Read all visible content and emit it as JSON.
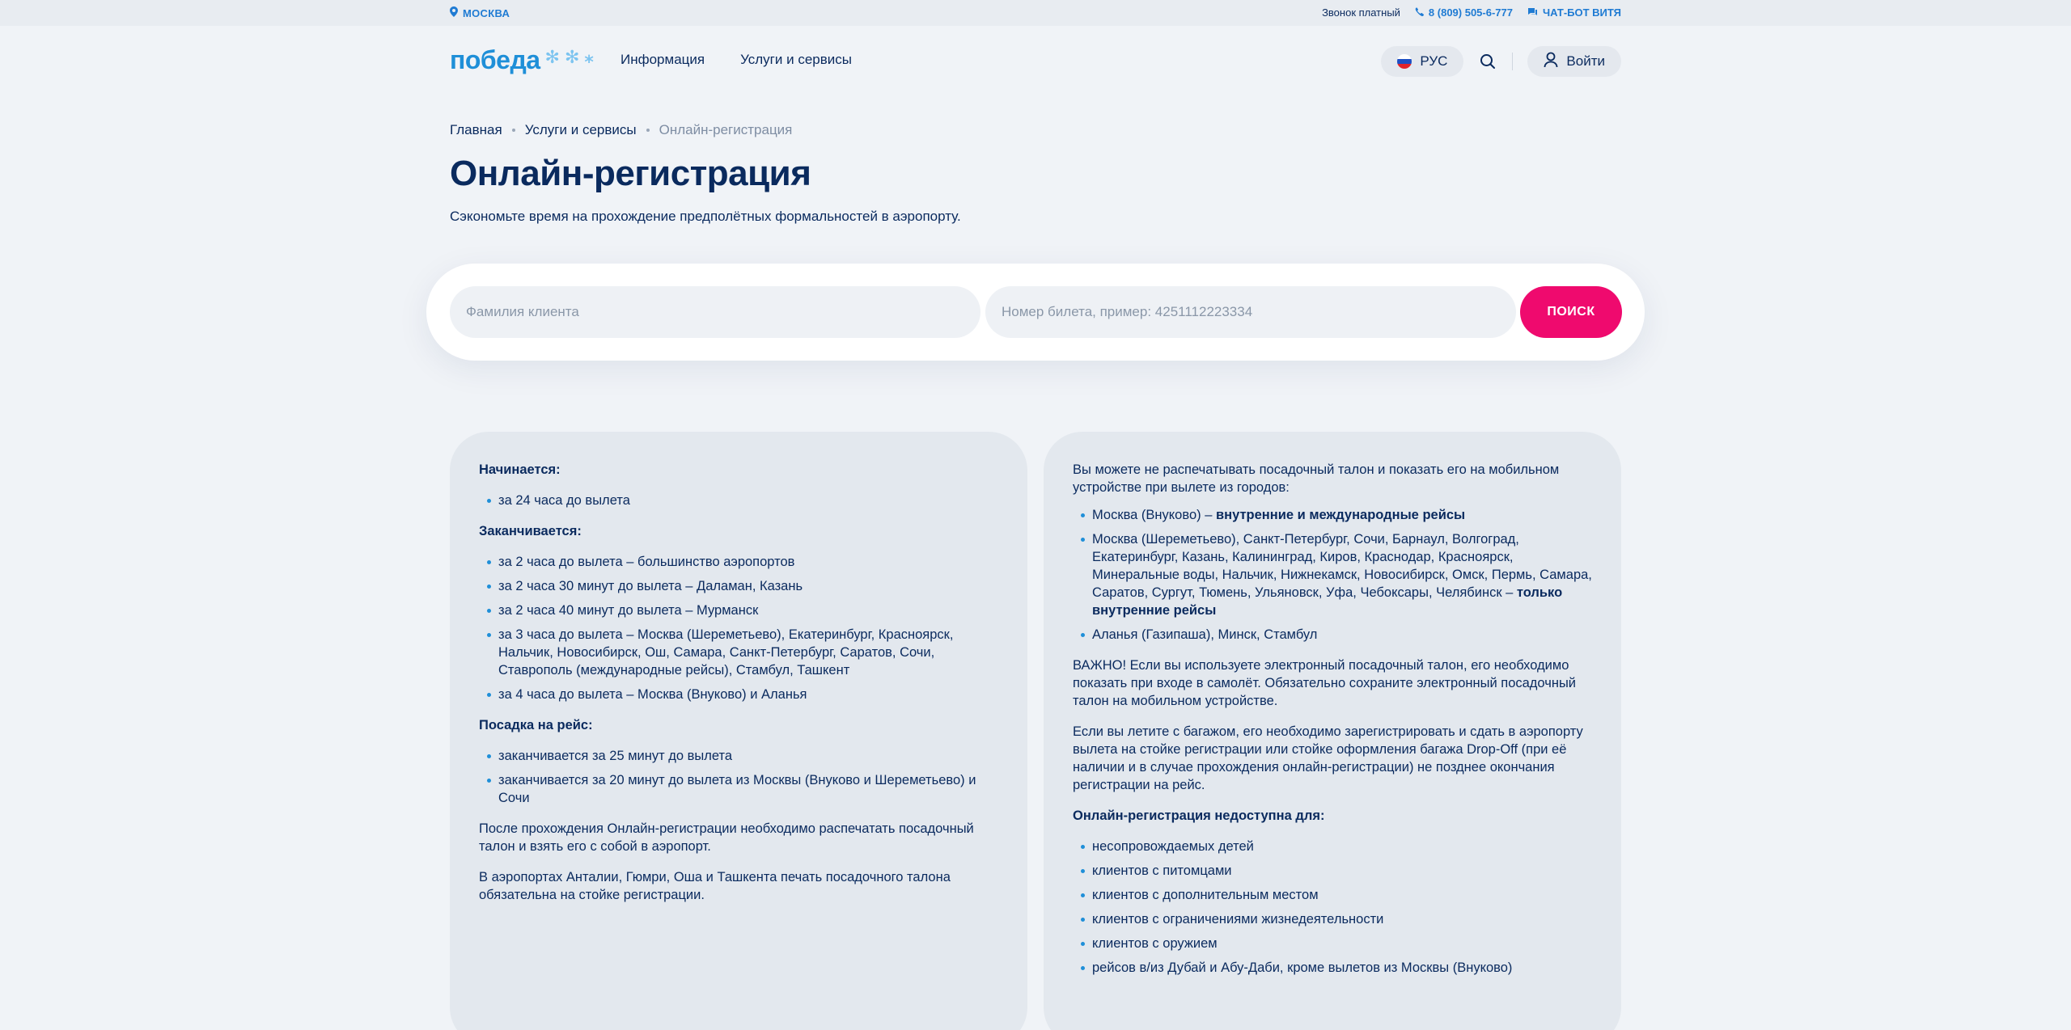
{
  "topbar": {
    "city": "МОСКВА",
    "paid_call": "Звонок платный",
    "phone": "8 (809) 505-6-777",
    "chat": "ЧАТ-БОТ ВИТЯ"
  },
  "header": {
    "logo": "победа",
    "nav": [
      "Информация",
      "Услуги и сервисы"
    ],
    "lang": "РУС",
    "login": "Войти"
  },
  "breadcrumb": [
    "Главная",
    "Услуги и сервисы",
    "Онлайн-регистрация"
  ],
  "page": {
    "title": "Онлайн-регистрация",
    "subtitle": "Сэкономьте время на прохождение предполётных формальностей в аэропорту."
  },
  "search": {
    "surname_placeholder": "Фамилия клиента",
    "ticket_placeholder": "Номер билета, пример: 4251112223334",
    "button": "ПОИСК"
  },
  "left_card": {
    "starts_title": "Начинается:",
    "starts": [
      "за 24 часа до вылета"
    ],
    "ends_title": "Заканчивается:",
    "ends": [
      "за 2 часа до вылета – большинство аэропортов",
      "за 2 часа 30 минут до вылета – Даламан, Казань",
      "за 2 часа 40 минут до вылета – Мурманск",
      "за 3 часа до вылета – Москва (Шереметьево), Екатеринбург, Красноярск, Нальчик, Новосибирск, Ош, Самара, Санкт-Петербург, Саратов, Сочи, Ставрополь (международные рейсы), Стамбул,  Ташкент",
      "за 4 часа до вылета – Москва (Внуково) и Аланья"
    ],
    "boarding_title": "Посадка на рейс:",
    "boarding": [
      "заканчивается за 25 минут до вылета",
      "заканчивается за 20 минут до вылета из Москвы (Внуково и Шереметьево) и Сочи"
    ],
    "p1": "После прохождения Онлайн-регистрации необходимо распечатать посадочный талон и взять его с собой в аэропорт.",
    "p2": "В аэропортах Анталии, Гюмри, Оша и Ташкента печать посадочного талона обязательна на стойке регистрации."
  },
  "right_card": {
    "intro": "Вы можете не распечатывать посадочный талон и показать его на мобильном устройстве при вылете из городов:",
    "city1_text": "Москва (Внуково) – ",
    "city1_bold": "внутренние и международные рейсы",
    "city2_text": "Москва (Шереметьево), Санкт-Петербург, Сочи, Барнаул, Волгоград, Екатеринбург, Казань, Калининград, Киров, Краснодар, Красноярск, Минеральные воды, Нальчик, Нижнекамск, Новосибирск, Омск, Пермь, Самара, Саратов, Сургут, Тюмень, Ульяновск, Уфа, Чебоксары, Челябинск – ",
    "city2_bold": "только внутренние рейсы",
    "city3_text": "Аланья (Газипаша), Минск, Стамбул",
    "p_important": "ВАЖНО! Если вы используете электронный посадочный талон, его необходимо показать при входе в самолёт. Обязательно сохраните электронный посадочный талон на мобильном устройстве.",
    "p_baggage": "Если вы летите с багажом, его необходимо зарегистрировать и сдать в аэропорту вылета на стойке регистрации или стойке оформления багажа Drop-Off (при её наличии и в случае прохождения онлайн-регистрации) не позднее окончания регистрации на рейс.",
    "unavailable_title": "Онлайн-регистрация недоступна для:",
    "unavailable": [
      "несопровождаемых детей",
      "клиентов с питомцами",
      "клиентов с дополнительным местом",
      "клиентов с ограничениями жизнедеятельности",
      "клиентов с оружием",
      "рейсов в/из Дубай и Абу-Даби, кроме вылетов из Москвы (Внуково)"
    ]
  },
  "colors": {
    "brand_blue": "#1f8fd8",
    "navy": "#0a2a5e",
    "accent_pink": "#ef0a6e",
    "background": "#f0f3f7"
  }
}
